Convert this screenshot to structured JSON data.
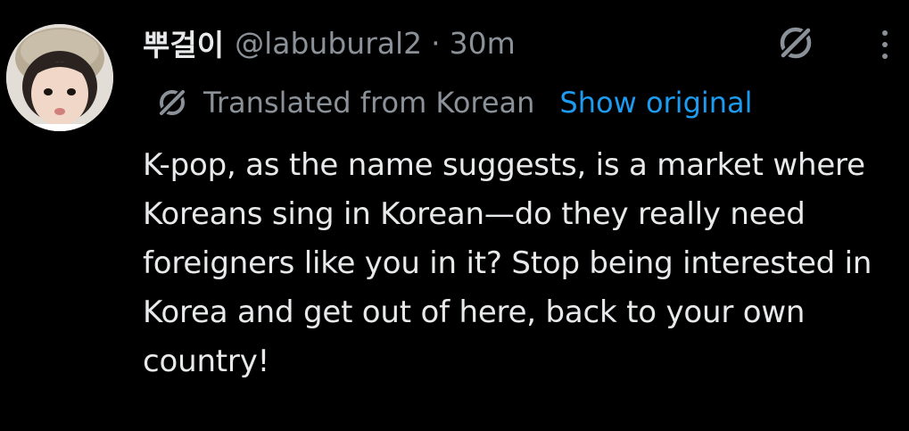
{
  "tweet": {
    "display_name": "뿌걸이",
    "handle": "@labubural2",
    "separator": "·",
    "timestamp": "30m",
    "translation": {
      "label": "Translated from Korean",
      "show_original": "Show original"
    },
    "text": "K-pop, as the name suggests, is a market where Koreans sing in Korean—do they really need foreigners like you in it? Stop being interested in Korea and get out of here, back to your own country!"
  },
  "icons": {
    "grok": "grok-icon",
    "more": "more-options-icon",
    "translate": "translate-icon",
    "avatar": "avatar"
  },
  "colors": {
    "background": "#000000",
    "primary_text": "#e7e9ea",
    "secondary_text": "#8b9198",
    "link": "#1d9bf0"
  }
}
